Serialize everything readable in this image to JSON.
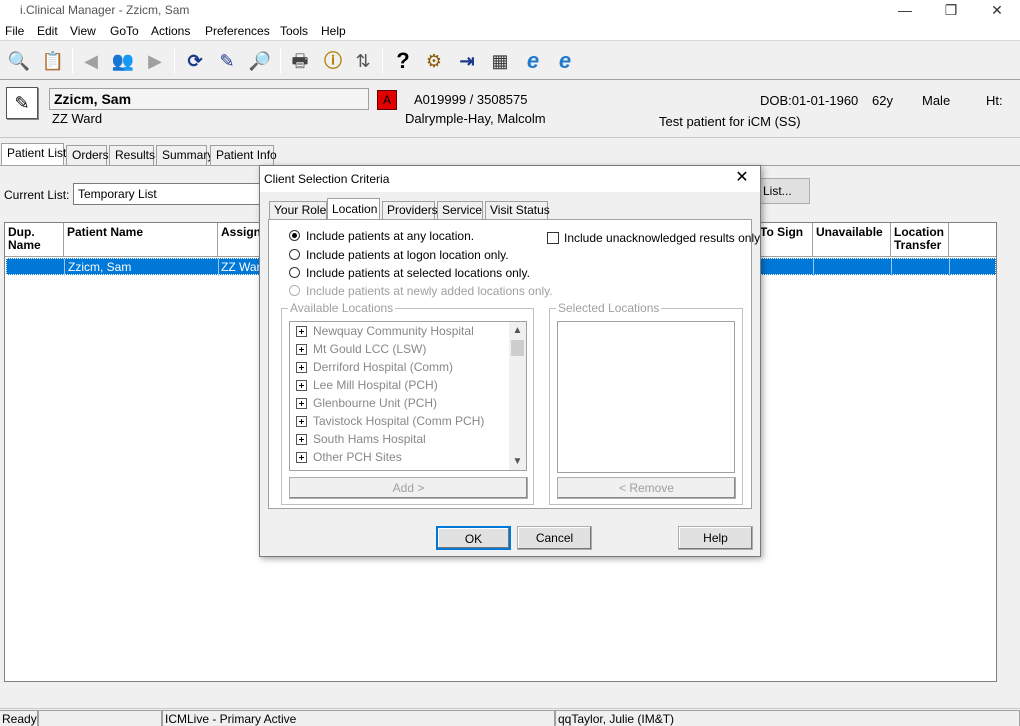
{
  "window": {
    "title": "i.Clinical Manager - Zzicm, Sam",
    "minimize": "—",
    "maximize": "❐",
    "close": "✕"
  },
  "menu": [
    "File",
    "Edit",
    "View",
    "GoTo",
    "Actions",
    "Preferences",
    "Tools",
    "Help"
  ],
  "toolbar_icons": [
    {
      "name": "patient-search-icon",
      "glyph": "🔍"
    },
    {
      "name": "patient-list-icon",
      "glyph": "📋"
    },
    {
      "name": "back-arrow-icon",
      "glyph": "◀"
    },
    {
      "name": "care-team-icon",
      "glyph": "👥"
    },
    {
      "name": "forward-arrow-icon",
      "glyph": "▶"
    },
    {
      "name": "refresh-icon",
      "glyph": "⟳"
    },
    {
      "name": "edit-note-icon",
      "glyph": "✎"
    },
    {
      "name": "find-icon",
      "glyph": "🔎"
    },
    {
      "name": "print-icon",
      "glyph": "🖶"
    },
    {
      "name": "info-icon",
      "glyph": "ⓘ"
    },
    {
      "name": "sort-az-icon",
      "glyph": "⇅"
    },
    {
      "name": "help-icon",
      "glyph": "?"
    },
    {
      "name": "tools-icon",
      "glyph": "⚙"
    },
    {
      "name": "exit-icon",
      "glyph": "⇥"
    },
    {
      "name": "calculator-icon",
      "glyph": "▦"
    },
    {
      "name": "internet-explorer-icon",
      "glyph": "e"
    },
    {
      "name": "internet-explorer-alt-icon",
      "glyph": "e"
    }
  ],
  "patient": {
    "name": "Zzicm, Sam",
    "ward": "ZZ Ward",
    "allergy_flag": "A",
    "ids": "A019999 / 3508575",
    "consultant": "Dalrymple-Hay, Malcolm",
    "dob": "DOB:01-01-1960",
    "age": "62y",
    "sex": "Male",
    "ht": "Ht:",
    "note": "Test patient for iCM (SS)"
  },
  "main_tabs": [
    "Patient List",
    "Orders",
    "Results",
    "Summary",
    "Patient Info"
  ],
  "current_list": {
    "label": "Current List:",
    "value": "Temporary List",
    "list_button": "List..."
  },
  "grid": {
    "columns": [
      "Dup. Name",
      "Patient Name",
      "Assigne",
      "To Sign",
      "Unavailable",
      "Location Transfer"
    ],
    "rows": [
      {
        "dup": "",
        "patient_name": "Zzicm, Sam",
        "assigned": "ZZ Ward"
      }
    ]
  },
  "dialog": {
    "title": "Client Selection Criteria",
    "close": "✕",
    "tabs": [
      "Your Role",
      "Location",
      "Providers",
      "Service",
      "Visit Status"
    ],
    "radios": [
      {
        "label": "Include patients at any location.",
        "checked": true,
        "disabled": false
      },
      {
        "label": "Include patients at logon location only.",
        "checked": false,
        "disabled": false
      },
      {
        "label": "Include patients at selected locations only.",
        "checked": false,
        "disabled": false
      },
      {
        "label": "Include patients at newly added locations only.",
        "checked": false,
        "disabled": true
      }
    ],
    "checkbox_label": "Include unacknowledged results only",
    "available_label": "Available Locations",
    "selected_label": "Selected Locations",
    "locations": [
      "Newquay Community Hospital",
      "Mt Gould LCC (LSW)",
      "Derriford Hospital (Comm)",
      "Lee Mill Hospital (PCH)",
      "Glenbourne Unit (PCH)",
      "Tavistock Hospital (Comm PCH)",
      "South Hams Hospital",
      "Other PCH Sites"
    ],
    "add_button": "Add >",
    "remove_button": "< Remove",
    "ok": "OK",
    "cancel": "Cancel",
    "help": "Help"
  },
  "status": {
    "ready": "Ready",
    "env": "ICMLive - Primary Active",
    "user": "qqTaylor, Julie (IM&T)"
  }
}
